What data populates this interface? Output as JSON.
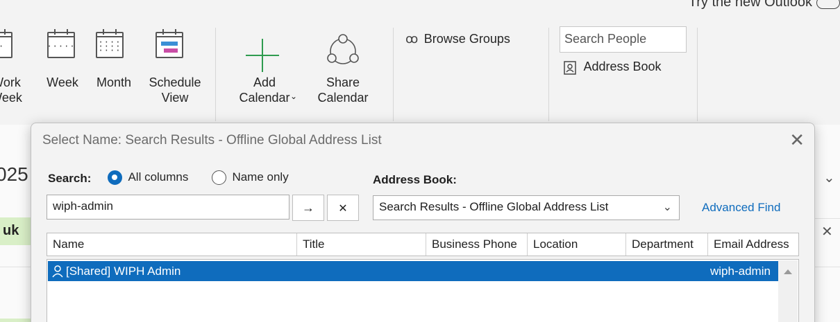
{
  "ribbon": {
    "try_new_outlook": "Try the new Outlook",
    "views": [
      {
        "label": "Work Week"
      },
      {
        "label": "Week"
      },
      {
        "label": "Month"
      },
      {
        "label": "Schedule View"
      }
    ],
    "add_calendar": "Add Calendar",
    "share_calendar": "Share Calendar",
    "browse_groups": "Browse Groups",
    "search_people_placeholder": "Search People",
    "address_book": "Address Book"
  },
  "background": {
    "date_fragment": "025",
    "tab_fragment": "uk"
  },
  "dialog": {
    "title": "Select Name: Search Results - Offline Global Address List",
    "search_label": "Search:",
    "radio_all_columns": "All columns",
    "radio_name_only": "Name only",
    "selected_radio": "All columns",
    "search_value": "wiph-admin",
    "go_glyph": "→",
    "clear_glyph": "✕",
    "address_book_label": "Address Book:",
    "address_book_value": "Search Results - Offline Global Address List",
    "advanced_find": "Advanced Find",
    "columns": [
      "Name",
      "Title",
      "Business Phone",
      "Location",
      "Department",
      "Email Address"
    ],
    "rows": [
      {
        "name": "[Shared] WIPH Admin",
        "title": "",
        "phone": "",
        "location": "",
        "department": "",
        "email": "wiph-admin"
      }
    ],
    "accent_color": "#0f6cbd"
  }
}
